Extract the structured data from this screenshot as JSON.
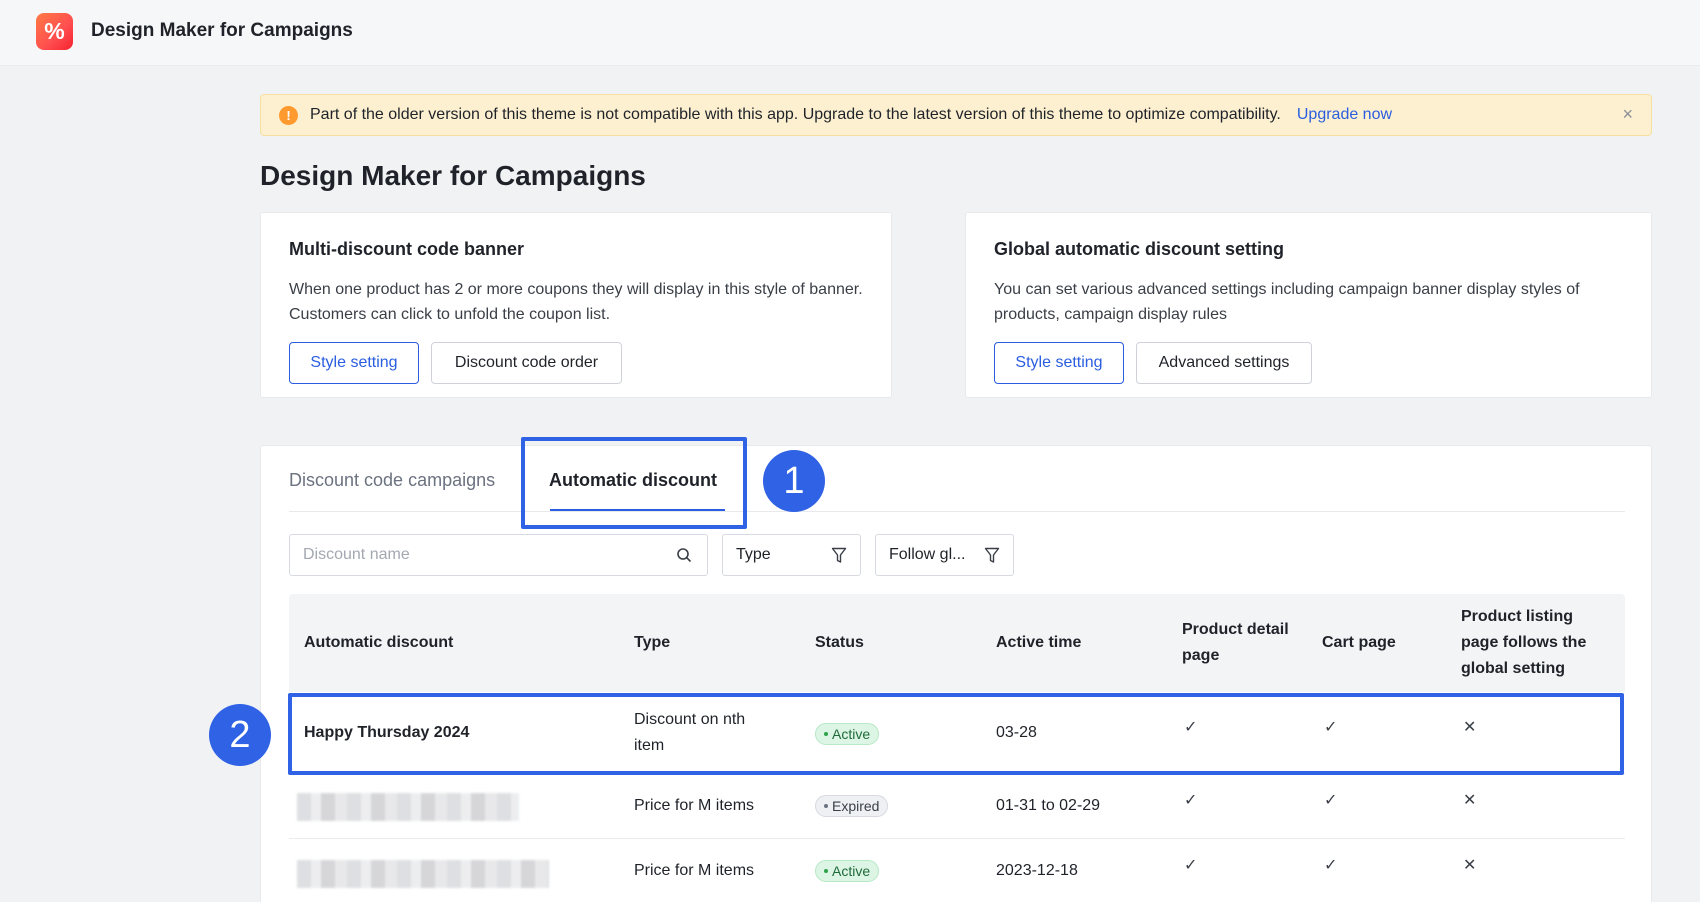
{
  "app": {
    "title": "Design Maker for Campaigns",
    "logo_glyph": "%"
  },
  "notice": {
    "icon": "!",
    "text": "Part of the older version of this theme is not compatible with this app. Upgrade to the latest version of this theme to optimize compatibility.",
    "link": "Upgrade now",
    "close": "×"
  },
  "page": {
    "title": "Design Maker for Campaigns"
  },
  "cards": {
    "multi": {
      "title": "Multi-discount code banner",
      "desc_line1": "When one product has 2 or more coupons they will display in this style of banner.",
      "desc_line2": "Customers can click to unfold the coupon list.",
      "btn_style": "Style setting",
      "btn_order": "Discount code order"
    },
    "global": {
      "title": "Global automatic discount setting",
      "desc_line1": "You can set various advanced settings including campaign banner display styles of",
      "desc_line2": "products, campaign display rules",
      "btn_style": "Style setting",
      "btn_advanced": "Advanced settings"
    }
  },
  "tabs": {
    "inactive": "Discount code campaigns",
    "active": "Automatic discount"
  },
  "filters": {
    "search_placeholder": "Discount name",
    "type": "Type",
    "follow": "Follow gl..."
  },
  "table": {
    "headers": {
      "name": "Automatic discount",
      "type": "Type",
      "status": "Status",
      "active_time": "Active time",
      "pdp_line1": "Product detail",
      "pdp_line2": "page",
      "cart": "Cart page",
      "plp_line1": "Product listing",
      "plp_line2": "page follows the",
      "plp_line3": "global setting"
    },
    "rows": [
      {
        "name": "Happy Thursday 2024",
        "type_line1": "Discount on nth",
        "type_line2": "item",
        "status": "Active",
        "time": "03-28",
        "pdp": "✓",
        "cart": "✓",
        "plp": "✕"
      },
      {
        "name": "",
        "type_line1": "Price for M items",
        "status": "Expired",
        "time": "01-31 to 02-29",
        "pdp": "✓",
        "cart": "✓",
        "plp": "✕"
      },
      {
        "name": "",
        "type_line1": "Price for M items",
        "status": "Active",
        "time": "2023-12-18",
        "pdp": "✓",
        "cart": "✓",
        "plp": "✕"
      }
    ]
  },
  "annotations": {
    "step1": "1",
    "step2": "2"
  },
  "colors": {
    "accent": "#2a5de0",
    "highlight": "#2f62e4",
    "notice_bg": "#fdf0d0",
    "warn": "#ff9a2e"
  }
}
